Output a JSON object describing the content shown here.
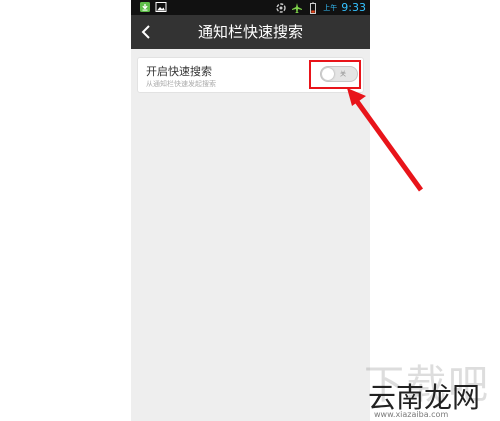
{
  "status_bar": {
    "time": "9:33",
    "ampm": "上午",
    "left_icons": [
      "download-icon",
      "image-icon"
    ],
    "right_icons": [
      "sync-icon",
      "airplane-icon",
      "battery-icon"
    ],
    "time_color": "#35c2ff"
  },
  "header": {
    "title": "通知栏快速搜索",
    "back_icon": "back-arrow-icon"
  },
  "setting": {
    "title": "开启快速搜索",
    "subtitle": "从通知栏快速发起搜索",
    "toggle_state": "关",
    "toggle_on": false
  },
  "annotation": {
    "highlight_color": "#e8141a"
  },
  "watermark": {
    "big": "下载吧",
    "brand": "云南龙网",
    "url": "www.xiazaiba.com"
  }
}
